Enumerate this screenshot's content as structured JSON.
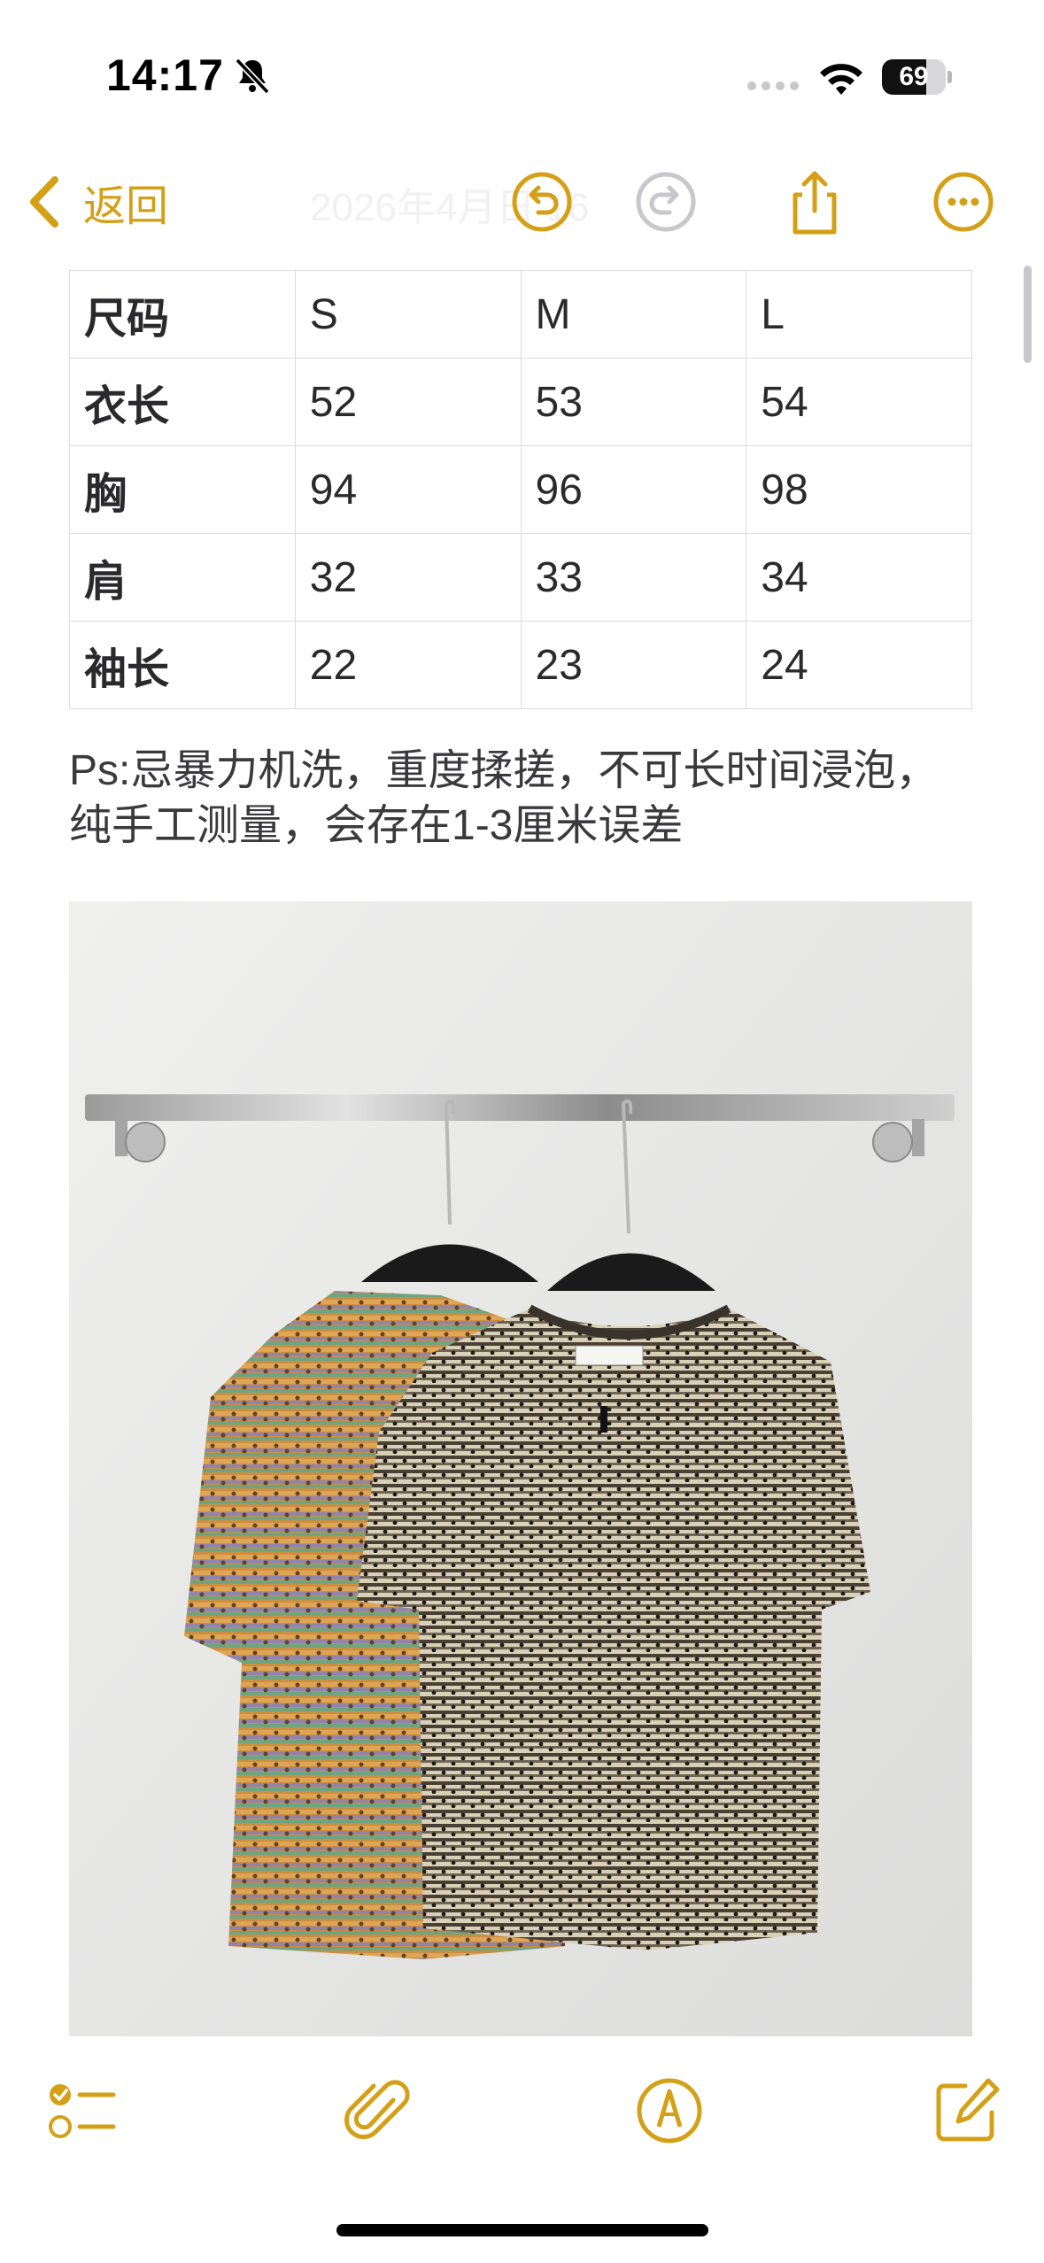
{
  "status_bar": {
    "time": "14:17",
    "battery_level": "69",
    "battery_fraction": 0.69,
    "icons": [
      "bell-slash-icon",
      "signal-icon",
      "wifi-icon",
      "battery-icon"
    ]
  },
  "nav": {
    "back_label": "返回",
    "ghost_title": "2026年4月日 16",
    "icons": [
      "chevron-left-icon",
      "undo-icon",
      "redo-icon",
      "share-icon",
      "more-icon"
    ]
  },
  "size_table": {
    "rows": [
      [
        "尺码",
        "S",
        "M",
        "L"
      ],
      [
        "衣长",
        "52",
        "53",
        "54"
      ],
      [
        "胸",
        "94",
        "96",
        "98"
      ],
      [
        "肩",
        "32",
        "33",
        "34"
      ],
      [
        "袖长",
        "22",
        "23",
        "24"
      ]
    ]
  },
  "note": {
    "line1": "Ps:忌暴力机洗，重度揉搓，不可长时间浸泡，",
    "line2": "纯手工测量，会存在1-3厘米误差"
  },
  "photo": {
    "subject": "two knit short-sleeve tops on black hangers hanging from a metal wall rail"
  },
  "toolbar": {
    "icons": [
      "checklist-icon",
      "paperclip-icon",
      "markup-pen-icon",
      "compose-icon"
    ]
  },
  "colors": {
    "accent": "#d4a017",
    "disabled": "#c7c7cc",
    "text": "#2a2a2c"
  }
}
